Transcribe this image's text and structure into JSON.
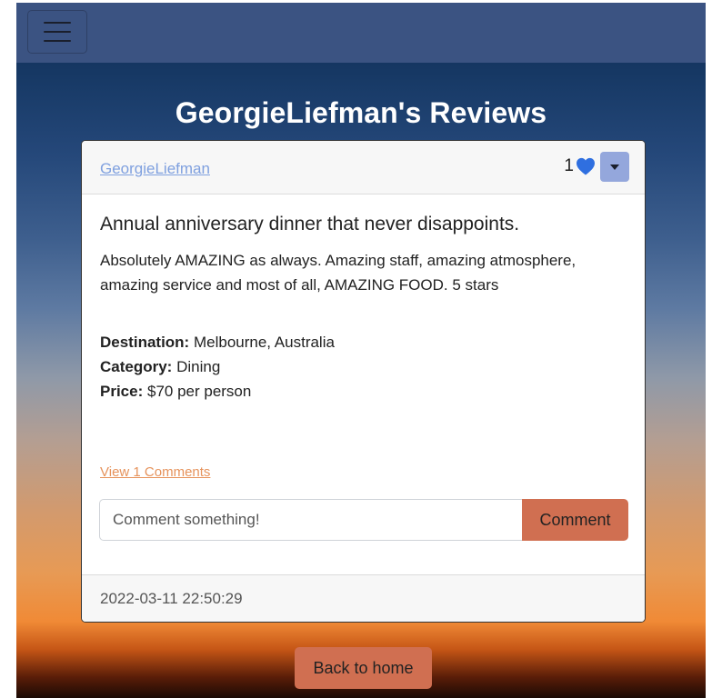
{
  "colors": {
    "navbar": "#3b5382",
    "accent": "#d06f51",
    "author_link": "#7fa0df",
    "comments_link": "#e6935c",
    "heart": "#2f6fe0",
    "dropdown": "#94a7dc"
  },
  "navbar": {
    "menu_icon": "hamburger-menu-icon"
  },
  "page": {
    "title": "GeorgieLiefman's Reviews"
  },
  "review": {
    "author": "GeorgieLiefman",
    "likes_count": "1",
    "like_icon": "heart-icon",
    "dropdown_icon": "caret-down-icon",
    "title": "Annual anniversary dinner that never disappoints.",
    "text": "Absolutely AMAZING as always. Amazing staff, amazing atmosphere, amazing service and most of all, AMAZING FOOD. 5 stars",
    "destination_label": "Destination:",
    "destination": "Melbourne, Australia",
    "category_label": "Category:",
    "category": "Dining",
    "price_label": "Price:",
    "price": "$70 per person",
    "comments_link": "View 1 Comments",
    "timestamp": "2022-03-11 22:50:29"
  },
  "comment_form": {
    "placeholder": "Comment something!",
    "value": "",
    "button_label": "Comment"
  },
  "footer": {
    "back_label": "Back to home"
  }
}
